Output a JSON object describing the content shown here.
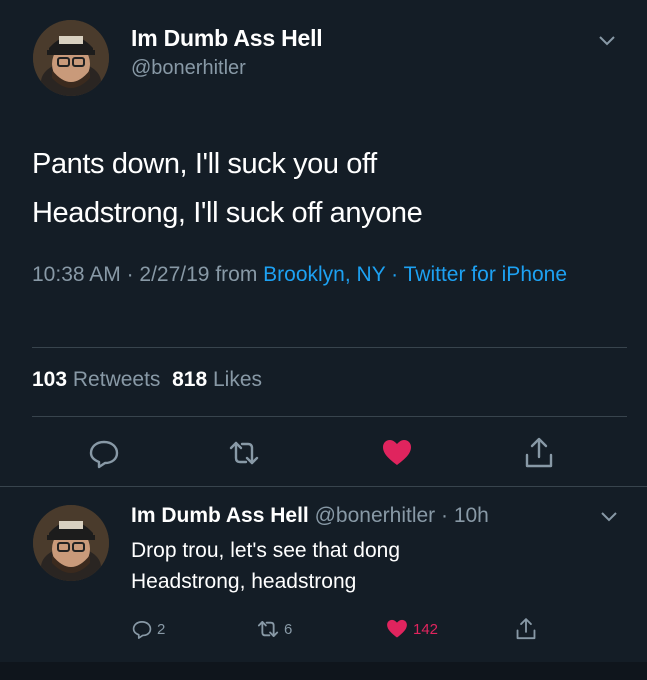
{
  "colors": {
    "background": "#141d26",
    "text": "#ffffff",
    "muted": "#8899a6",
    "link": "#1da1f2",
    "like": "#e0245e",
    "divider": "#38444d"
  },
  "main_tweet": {
    "display_name": "Im Dumb Ass Hell",
    "handle": "@bonerhitler",
    "text_lines": [
      "Pants down, I'll suck you off",
      "Headstrong, I'll suck off anyone"
    ],
    "time": "10:38 AM",
    "sep1": " · ",
    "date": "2/27/19",
    "from": " from ",
    "location": "Brooklyn, NY",
    "sep2": " · ",
    "source": "Twitter for iPhone",
    "retweet_count": "103",
    "retweet_label": "Retweets",
    "like_count": "818",
    "like_label": "Likes",
    "actions": [
      "reply-icon",
      "retweet-icon",
      "heart-icon",
      "share-icon"
    ]
  },
  "reply_tweet": {
    "display_name": "Im Dumb Ass Hell",
    "handle": "@bonerhitler",
    "dot": " · ",
    "age": "10h",
    "text_lines": [
      "Drop trou, let's see that dong",
      "Headstrong, headstrong"
    ],
    "reply_count": "2",
    "retweet_count": "6",
    "like_count": "142"
  }
}
